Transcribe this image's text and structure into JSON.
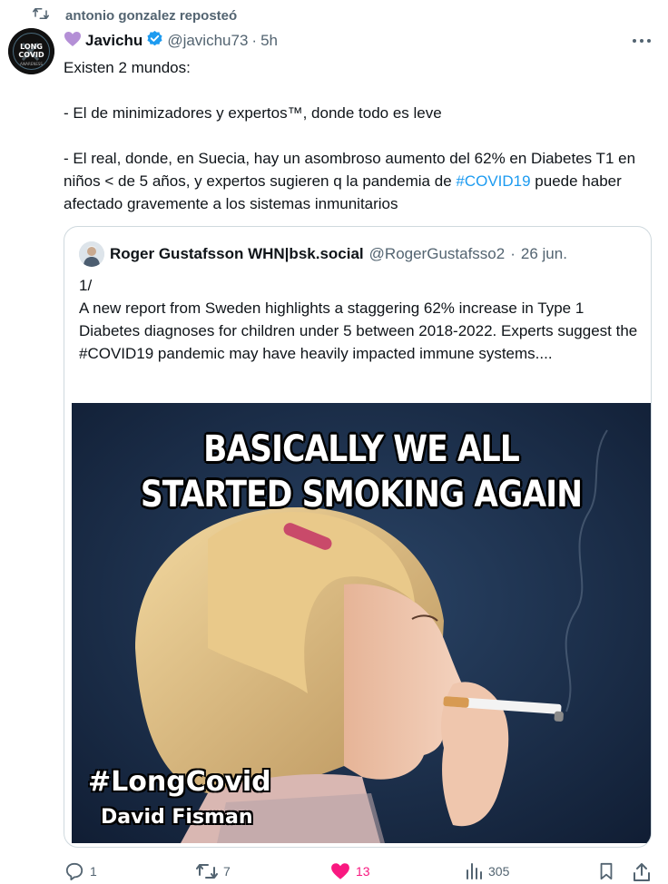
{
  "repost": {
    "icon": "repost-icon",
    "text": "antonio gonzalez reposteó"
  },
  "tweet": {
    "display_name": "Javichu",
    "name_emoji": "purple-heart-icon",
    "verified_icon": "verified-badge-icon",
    "handle": "@javichu73",
    "separator": "·",
    "time": "5h",
    "avatar": {
      "lines": [
        "LONG",
        "COVID",
        "AWARENESS"
      ]
    },
    "body": {
      "line1": "Existen 2 mundos:",
      "line2": "-  El de minimizadores y expertos™, donde todo es leve",
      "line3_a": "- El real, donde, en Suecia, hay un asombroso aumento del 62% en Diabetes T1 en niños < de 5 años, y expertos sugieren q la pandemia de ",
      "line3_link": "#COVID19",
      "line3_b": " puede haber afectado gravemente a los sistemas inmunitarios"
    }
  },
  "quote": {
    "display_name": "Roger Gustafsson WHN|bsk.social",
    "handle": "@RogerGustafsso2",
    "separator": "·",
    "time": "26 jun.",
    "text": "1/\nA new report from Sweden highlights a staggering 62% increase in Type 1 Diabetes diagnoses for children under 5 between 2018-2022. Experts suggest the #COVID19 pandemic may have heavily impacted immune systems....",
    "image": {
      "top_line1": "BASICALLY WE ALL",
      "top_line2": "STARTED SMOKING AGAIN",
      "tag": "#LongCovid",
      "credit": "David Fisman"
    }
  },
  "actions": {
    "reply": {
      "icon": "reply-icon",
      "count": "1"
    },
    "repost": {
      "icon": "repost-icon",
      "count": "7"
    },
    "like": {
      "icon": "heart-filled-icon",
      "count": "13",
      "color": "#f91880"
    },
    "views": {
      "icon": "views-icon",
      "count": "305"
    },
    "bookmark": {
      "icon": "bookmark-icon"
    },
    "share": {
      "icon": "share-icon"
    }
  },
  "colors": {
    "link": "#1d9bf0",
    "muted": "#536471",
    "text": "#0f1419",
    "border": "#cfd9de",
    "verified": "#1d9bf0",
    "like": "#f91880"
  }
}
